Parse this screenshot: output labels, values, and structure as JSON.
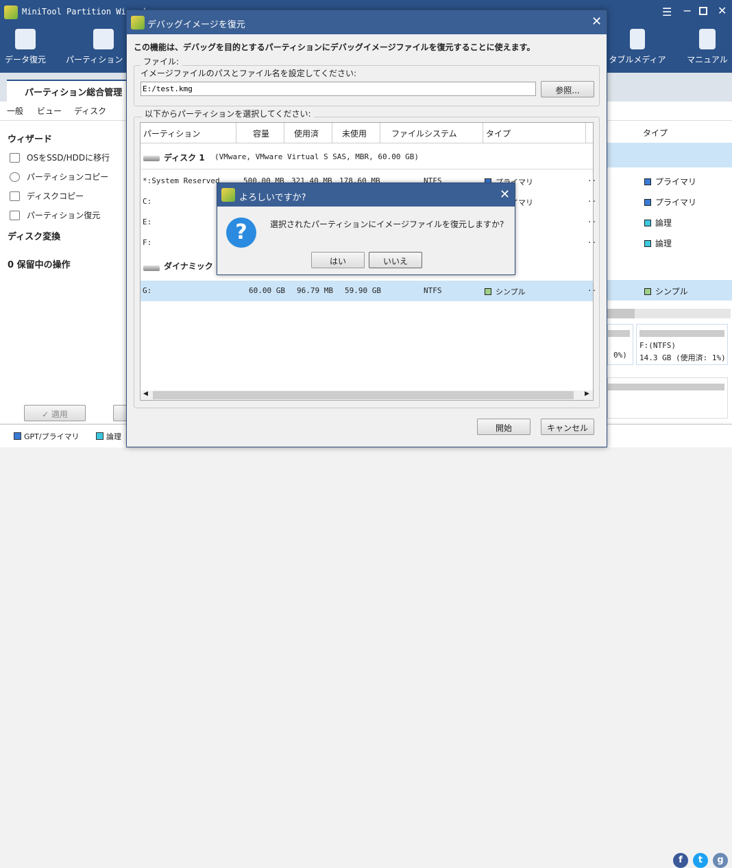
{
  "app": {
    "title": "MiniTool Partition Wizard",
    "toolbar": [
      {
        "label": "データ復元",
        "icon": "data-recovery-icon"
      },
      {
        "label": "パーティション",
        "icon": "partition-recovery-icon"
      },
      {
        "label": "タブルメディア",
        "icon": "bootable-media-icon"
      },
      {
        "label": "マニュアル",
        "icon": "manual-icon"
      }
    ],
    "tab": "パーティション総合管理",
    "menu": [
      "一般",
      "ビュー",
      "ディスク"
    ],
    "sidebar": {
      "wizard_heading": "ウィザード",
      "items": [
        "OSをSSD/HDDに移行",
        "パーティションコピー",
        "ディスクコピー",
        "パーティション復元"
      ],
      "convert_heading": "ディスク変換",
      "pending_heading": "0 保留中の操作"
    },
    "apply_button": "✓ 適用",
    "legend": [
      "GPT/プライマリ",
      "論理"
    ],
    "right_pane": {
      "type_header": "タイプ",
      "types": [
        "プライマリ",
        "プライマリ",
        "論理",
        "論理",
        "シンプル"
      ],
      "disk_f_label": "F:(NTFS)",
      "disk_f_size": "14.3 GB (使用済: 1%)",
      "disk_e_pct": "0%)"
    }
  },
  "dialog": {
    "title": "デバッグイメージを復元",
    "description": "この機能は、デバッグを目的とするパーティションにデバッグイメージファイルを復元することに使えます。",
    "file_group_label": "ファイル:",
    "file_prompt": "イメージファイルのパスとファイル名を設定してください:",
    "file_path": "E:/test.kmg",
    "browse_button": "参照...",
    "select_group_label": "以下からパーティションを選択してください:",
    "columns": [
      "パーティション",
      "容量",
      "使用済",
      "未使用",
      "ファイルシステム",
      "タイプ"
    ],
    "disk1_label": "ディスク 1",
    "disk1_info": "(VMware, VMware Virtual S SAS, MBR, 60.00 GB)",
    "dynamic_label": "ダイナミック",
    "rows": [
      {
        "partition": "*:System Reserved",
        "capacity": "500.00 MB",
        "used": "321.40 MB",
        "unused": "178.60 MB",
        "fs": "NTFS",
        "type": "プライマリ",
        "color": "#3a7bd5"
      },
      {
        "partition": "C:",
        "capacity": "",
        "used": "",
        "unused": "",
        "fs": "",
        "type": "プライマリ",
        "color": "#3a7bd5"
      },
      {
        "partition": "E:",
        "capacity": "",
        "used": "",
        "unused": "",
        "fs": "",
        "type": "",
        "color": ""
      },
      {
        "partition": "F:",
        "capacity": "",
        "used": "",
        "unused": "",
        "fs": "",
        "type": "",
        "color": ""
      }
    ],
    "dynamic_row": {
      "partition": "G:",
      "capacity": "60.00 GB",
      "used": "96.79 MB",
      "unused": "59.90 GB",
      "fs": "NTFS",
      "type": "シンプル",
      "color": "#9fd08a"
    },
    "start_button": "開始",
    "cancel_button": "キャンセル"
  },
  "confirm": {
    "title": "よろしいですか?",
    "message": "選択されたパーティションにイメージファイルを復元しますか?",
    "yes_button": "はい",
    "no_button": "いいえ"
  },
  "colors": {
    "titlebar": "#2b5289",
    "dialog_title": "#3a5f94",
    "primary": "#3a7bd5",
    "logical": "#3cc7dd",
    "simple": "#9fd08a",
    "selected_row": "#cce4f7"
  }
}
